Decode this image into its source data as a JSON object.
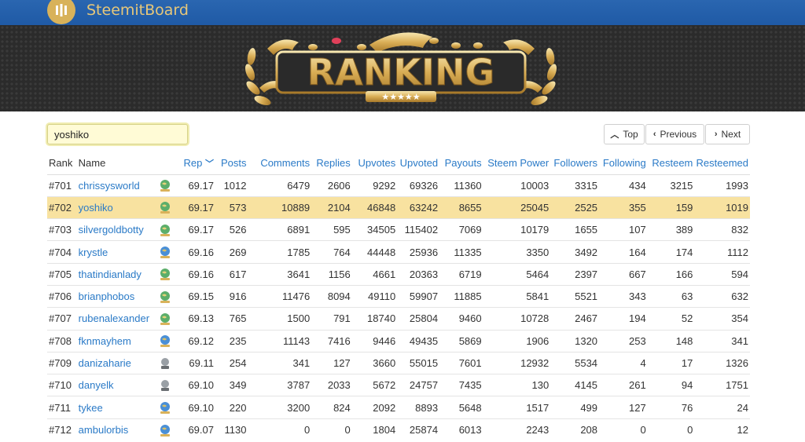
{
  "app": {
    "brand": "SteemitBoard"
  },
  "banner": {
    "title": "RANKING",
    "stars": "★★★★★"
  },
  "search": {
    "value": "yoshiko",
    "placeholder": ""
  },
  "pager": {
    "top": "Top",
    "previous": "Previous",
    "next": "Next"
  },
  "colors": {
    "topbar": "#1f5aa6",
    "accent": "#2a7ac7",
    "highlight": "#f8e2a0",
    "gold": "#d8b25a"
  },
  "table": {
    "headers": {
      "rank": "Rank",
      "name": "Name",
      "rep": "Rep",
      "posts": "Posts",
      "comments": "Comments",
      "replies": "Replies",
      "upvotes": "Upvotes",
      "upvoted": "Upvoted",
      "payouts": "Payouts",
      "steem_power": "Steem Power",
      "followers": "Followers",
      "following": "Following",
      "resteem": "Resteem",
      "resteemed": "Resteemed"
    },
    "sort_icon": "chevron-down-icon",
    "rows": [
      {
        "rank": "#701",
        "name": "chrissysworld",
        "badge": "earth-badge",
        "rep": "69.17",
        "posts": "1012",
        "comments": "6479",
        "replies": "2606",
        "upvotes": "9292",
        "upvoted": "69326",
        "payouts": "11360",
        "sp": "10003",
        "followers": "3315",
        "following": "434",
        "resteem": "3215",
        "resteemed": "1993"
      },
      {
        "rank": "#702",
        "name": "yoshiko",
        "badge": "earth-badge",
        "rep": "69.17",
        "posts": "573",
        "comments": "10889",
        "replies": "2104",
        "upvotes": "46848",
        "upvoted": "63242",
        "payouts": "8655",
        "sp": "25045",
        "followers": "2525",
        "following": "355",
        "resteem": "159",
        "resteemed": "1019",
        "highlight": true
      },
      {
        "rank": "#703",
        "name": "silvergoldbotty",
        "badge": "earth-badge",
        "rep": "69.17",
        "posts": "526",
        "comments": "6891",
        "replies": "595",
        "upvotes": "34505",
        "upvoted": "115402",
        "payouts": "7069",
        "sp": "10179",
        "followers": "1655",
        "following": "107",
        "resteem": "389",
        "resteemed": "832"
      },
      {
        "rank": "#704",
        "name": "krystle",
        "badge": "globe-badge",
        "rep": "69.16",
        "posts": "269",
        "comments": "1785",
        "replies": "764",
        "upvotes": "44448",
        "upvoted": "25936",
        "payouts": "11335",
        "sp": "3350",
        "followers": "3492",
        "following": "164",
        "resteem": "174",
        "resteemed": "1112"
      },
      {
        "rank": "#705",
        "name": "thatindianlady",
        "badge": "earth-badge",
        "rep": "69.16",
        "posts": "617",
        "comments": "3641",
        "replies": "1156",
        "upvotes": "4661",
        "upvoted": "20363",
        "payouts": "6719",
        "sp": "5464",
        "followers": "2397",
        "following": "667",
        "resteem": "166",
        "resteemed": "594"
      },
      {
        "rank": "#706",
        "name": "brianphobos",
        "badge": "earth-badge",
        "rep": "69.15",
        "posts": "916",
        "comments": "11476",
        "replies": "8094",
        "upvotes": "49110",
        "upvoted": "59907",
        "payouts": "11885",
        "sp": "5841",
        "followers": "5521",
        "following": "343",
        "resteem": "63",
        "resteemed": "632"
      },
      {
        "rank": "#707",
        "name": "rubenalexander",
        "badge": "earth-badge",
        "rep": "69.13",
        "posts": "765",
        "comments": "1500",
        "replies": "791",
        "upvotes": "18740",
        "upvoted": "25804",
        "payouts": "9460",
        "sp": "10728",
        "followers": "2467",
        "following": "194",
        "resteem": "52",
        "resteemed": "354"
      },
      {
        "rank": "#708",
        "name": "fknmayhem",
        "badge": "globe-badge",
        "rep": "69.12",
        "posts": "235",
        "comments": "11143",
        "replies": "7416",
        "upvotes": "9446",
        "upvoted": "49435",
        "payouts": "5869",
        "sp": "1906",
        "followers": "1320",
        "following": "253",
        "resteem": "148",
        "resteemed": "341"
      },
      {
        "rank": "#709",
        "name": "danizaharie",
        "badge": "moon-badge",
        "rep": "69.11",
        "posts": "254",
        "comments": "341",
        "replies": "127",
        "upvotes": "3660",
        "upvoted": "55015",
        "payouts": "7601",
        "sp": "12932",
        "followers": "5534",
        "following": "4",
        "resteem": "17",
        "resteemed": "1326"
      },
      {
        "rank": "#710",
        "name": "danyelk",
        "badge": "moon-badge",
        "rep": "69.10",
        "posts": "349",
        "comments": "3787",
        "replies": "2033",
        "upvotes": "5672",
        "upvoted": "24757",
        "payouts": "7435",
        "sp": "130",
        "followers": "4145",
        "following": "261",
        "resteem": "94",
        "resteemed": "1751"
      },
      {
        "rank": "#711",
        "name": "tykee",
        "badge": "globe-badge",
        "rep": "69.10",
        "posts": "220",
        "comments": "3200",
        "replies": "824",
        "upvotes": "2092",
        "upvoted": "8893",
        "payouts": "5648",
        "sp": "1517",
        "followers": "499",
        "following": "127",
        "resteem": "76",
        "resteemed": "24"
      },
      {
        "rank": "#712",
        "name": "ambulorbis",
        "badge": "globe-badge",
        "rep": "69.07",
        "posts": "1130",
        "comments": "0",
        "replies": "0",
        "upvotes": "1804",
        "upvoted": "25874",
        "payouts": "6013",
        "sp": "2243",
        "followers": "208",
        "following": "0",
        "resteem": "0",
        "resteemed": "12"
      }
    ]
  }
}
